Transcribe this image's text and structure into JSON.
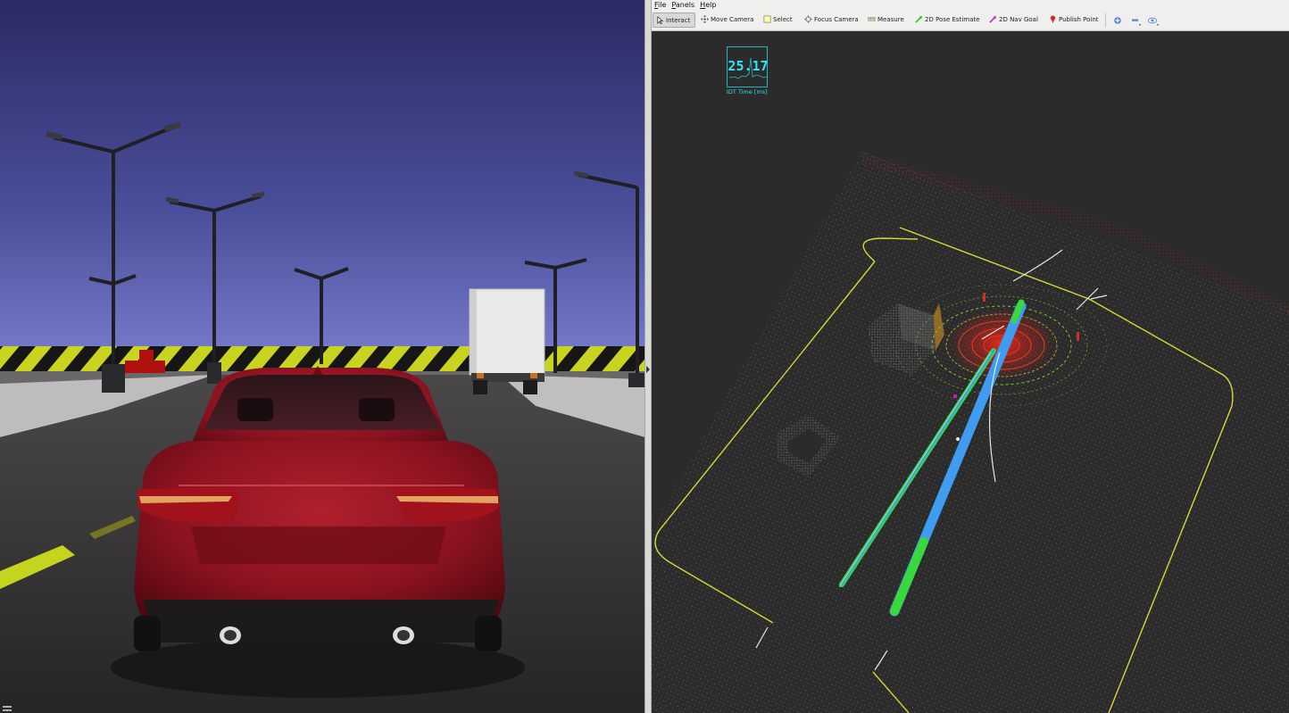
{
  "rviz": {
    "menu": [
      "File",
      "Panels",
      "Help"
    ],
    "tools": [
      {
        "label": "Interact",
        "icon": "cursor-icon",
        "active": true
      },
      {
        "label": "Move Camera",
        "icon": "move-camera-icon"
      },
      {
        "label": "Select",
        "icon": "select-icon"
      },
      {
        "label": "Focus Camera",
        "icon": "focus-camera-icon"
      },
      {
        "label": "Measure",
        "icon": "measure-icon"
      },
      {
        "label": "2D Pose Estimate",
        "icon": "green-arrow-icon"
      },
      {
        "label": "2D Nav Goal",
        "icon": "magenta-arrow-icon"
      },
      {
        "label": "Publish Point",
        "icon": "red-pin-icon"
      }
    ],
    "extra_icons": [
      "add-icon",
      "remove-icon",
      "eye-icon"
    ],
    "overlay": {
      "value": "25.17",
      "label": "IDT Time [ms]"
    }
  },
  "colors": {
    "sky_top": "#2b2b66",
    "sky_bottom": "#6d73c4",
    "car_body": "#8b1220",
    "overlay_cyan": "#35e3f0",
    "path_blue": "#3f9cf0",
    "path_green": "#38d93a",
    "boundary_yellow": "#d7d635"
  }
}
